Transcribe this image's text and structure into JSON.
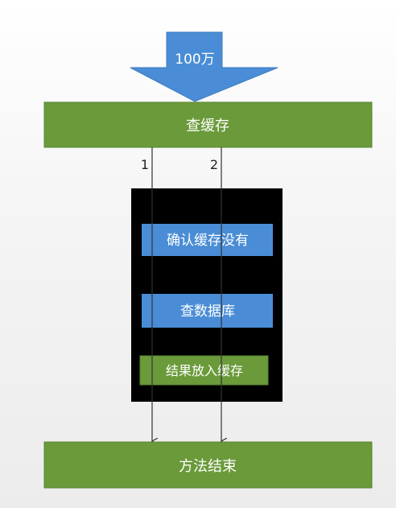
{
  "arrow": {
    "label": "100万"
  },
  "top_box": {
    "label": "查缓存"
  },
  "threads": [
    {
      "label": "1"
    },
    {
      "label": "2"
    }
  ],
  "steps": [
    {
      "label": "确认缓存没有"
    },
    {
      "label": "查数据库"
    },
    {
      "label": "结果放入缓存"
    }
  ],
  "bottom_box": {
    "label": "方法结束"
  },
  "colors": {
    "green": "#6a9a3a",
    "green_border": "#5a8530",
    "blue": "#4a8dd6",
    "block_bg": "#000000",
    "text_light": "#ffffff",
    "line": "#333333"
  }
}
